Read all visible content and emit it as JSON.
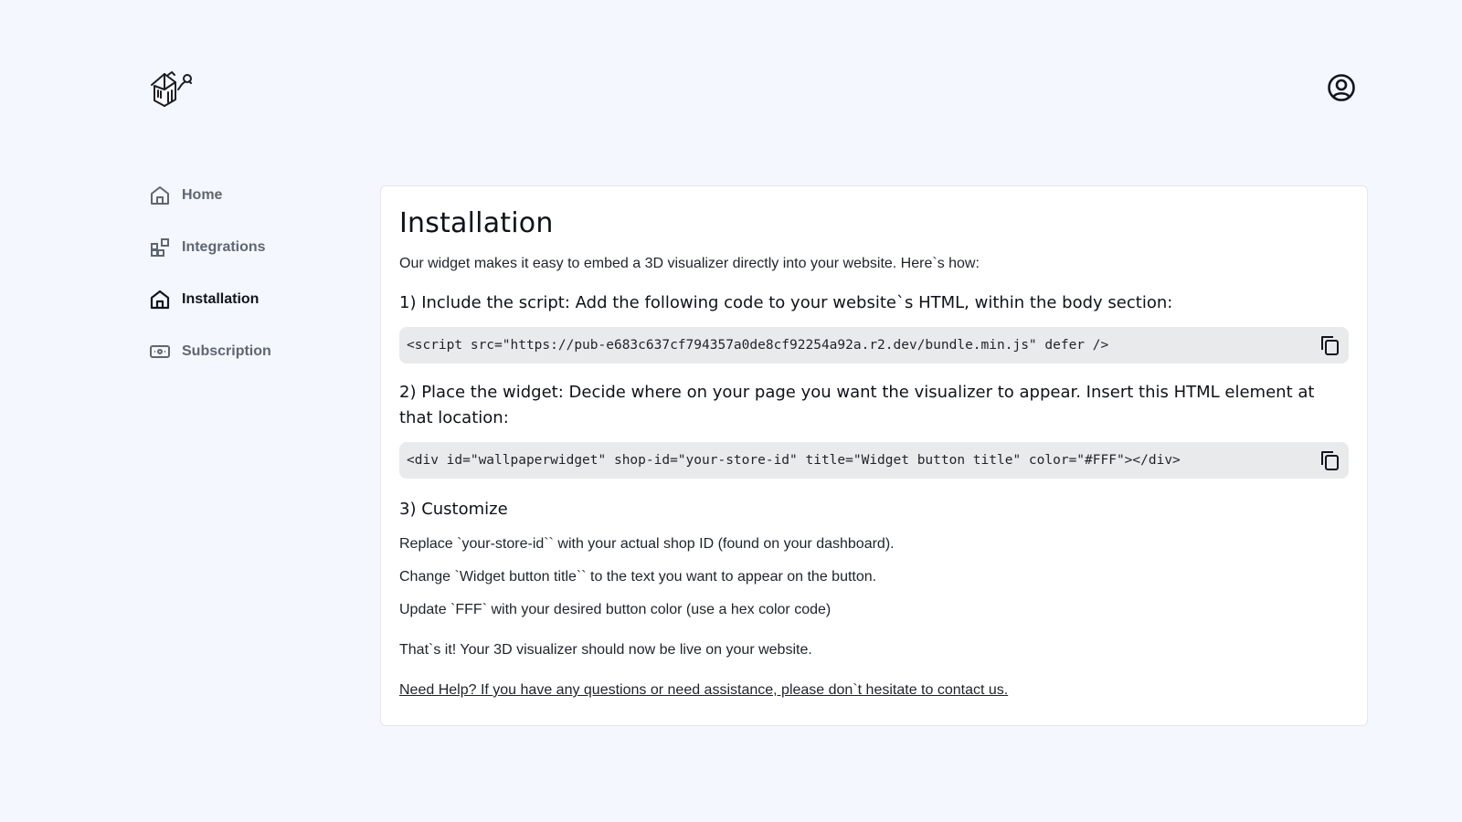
{
  "header": {
    "logo_icon": "house-logo-icon",
    "account_icon": "user-circle-icon"
  },
  "sidebar": {
    "items": [
      {
        "label": "Home",
        "icon": "home-icon",
        "active": false
      },
      {
        "label": "Integrations",
        "icon": "integrations-icon",
        "active": false
      },
      {
        "label": "Installation",
        "icon": "home-icon",
        "active": true
      },
      {
        "label": "Subscription",
        "icon": "subscription-icon",
        "active": false
      }
    ]
  },
  "main": {
    "title": "Installation",
    "intro": "Our widget makes it easy to embed a 3D visualizer directly into your website. Here`s how:",
    "step1_title": "1) Include the script: Add the following code to your website`s HTML, within the body section:",
    "code1": "<script src=\"https://pub-e683c637cf794357a0de8cf92254a92a.r2.dev/bundle.min.js\" defer />",
    "step2_title": "2) Place the widget: Decide where on your page you want the visualizer to appear. Insert this HTML element at that location:",
    "code2": "<div id=\"wallpaperwidget\" shop-id=\"your-store-id\" title=\"Widget button title\" color=\"#FFF\"></div>",
    "step3_title": "3) Customize",
    "customize": [
      "Replace `your-store-id`` with your actual shop ID (found on your dashboard).",
      "Change `Widget button title`` to the text you want to appear on the button.",
      "Update `FFF` with your desired button color (use a hex color code)"
    ],
    "done": "That`s it! Your 3D visualizer should now be live on your website.",
    "help_link": "Need Help? If you have any questions or need assistance, please don`t hesitate to contact us.",
    "copy_icon": "copy-icon"
  },
  "colors": {
    "background": "#f4f7fe",
    "card": "#ffffff",
    "code_bg": "#e9eaec",
    "text": "#1f2329",
    "muted": "#5f6672"
  }
}
